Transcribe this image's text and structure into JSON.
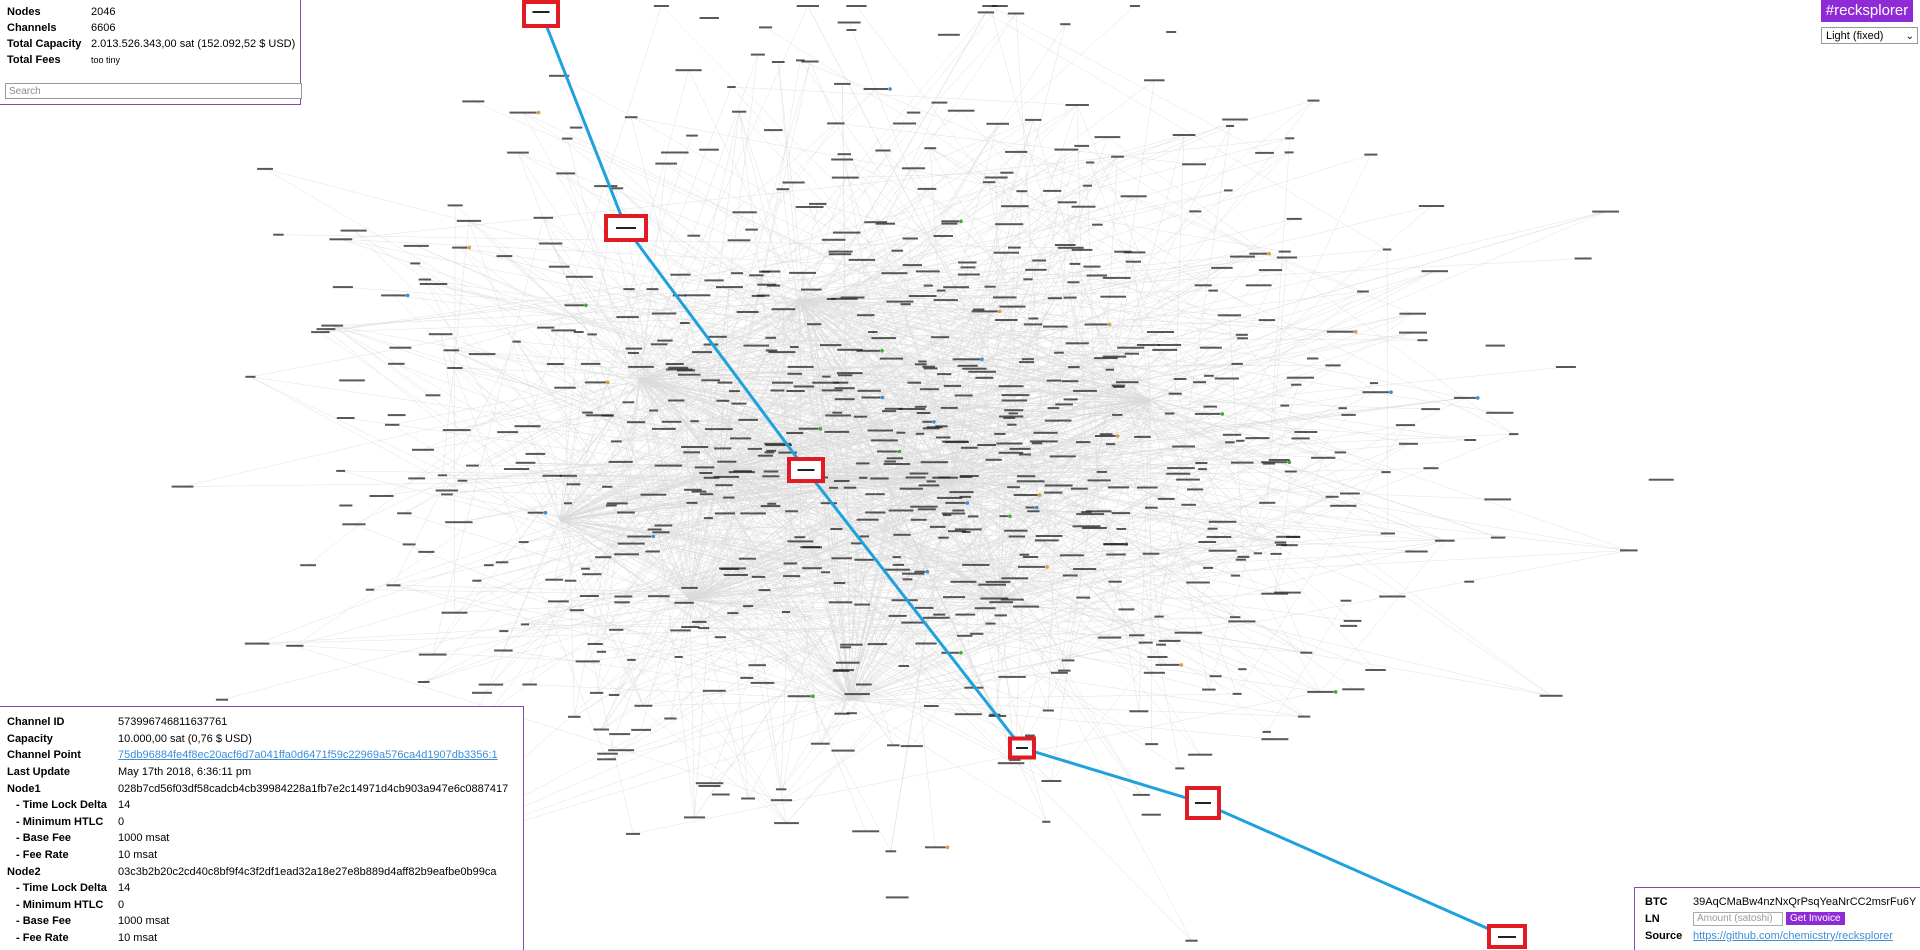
{
  "stats": {
    "nodes_label": "Nodes",
    "nodes": "2046",
    "channels_label": "Channels",
    "channels": "6606",
    "capacity_label": "Total Capacity",
    "capacity": "2.013.526.343,00 sat (152.092,52 $ USD)",
    "fees_label": "Total Fees",
    "fees": "too tiny",
    "search_placeholder": "Search"
  },
  "brand": "#recksplorer",
  "theme": {
    "selected": "Light (fixed)",
    "chevron_icon": "chevron-down-icon"
  },
  "channel": {
    "id_label": "Channel ID",
    "id": "573996746811637761",
    "capacity_label": "Capacity",
    "capacity": "10.000,00 sat (0,76 $ USD)",
    "point_label": "Channel Point",
    "point": "75db96884fe4f8ec20acf6d7a041ffa0d6471f59c22969a576ca4d1907db3356:1",
    "update_label": "Last Update",
    "update": "May 17th 2018, 6:36:11 pm",
    "node1_label": "Node1",
    "node1": "028b7cd56f03df58cadcb4cb39984228a1fb7e2c14971d4cb903a947e6c0887417",
    "node2_label": "Node2",
    "node2": "03c3b2b20c2cd40c8bf9f4c3f2df1ead32a18e27e8b889d4aff82b9eafbe0b99ca",
    "tld_label": "- Time Lock Delta",
    "minhtlc_label": "- Minimum HTLC",
    "basefee_label": "- Base Fee",
    "feerate_label": "- Fee Rate",
    "node1_tld": "14",
    "node1_minhtlc": "0",
    "node1_basefee": "1000 msat",
    "node1_feerate": "10 msat",
    "node2_tld": "14",
    "node2_minhtlc": "0",
    "node2_basefee": "1000 msat",
    "node2_feerate": "10 msat"
  },
  "donate": {
    "btc_label": "BTC",
    "btc": "39AqCMaBw4nzNxQrPsqYeaNrCC2msrFu6Y",
    "ln_label": "LN",
    "amount_placeholder": "Amount (satoshi)",
    "invoice_button": "Get Invoice",
    "source_label": "Source",
    "source": "https://github.com/chemicstry/recksplorer"
  },
  "colors": {
    "accent": "#8e2ad6",
    "path": "#1ea1dc",
    "highlight": "#e01b24",
    "edge": "#d9d9d9"
  }
}
